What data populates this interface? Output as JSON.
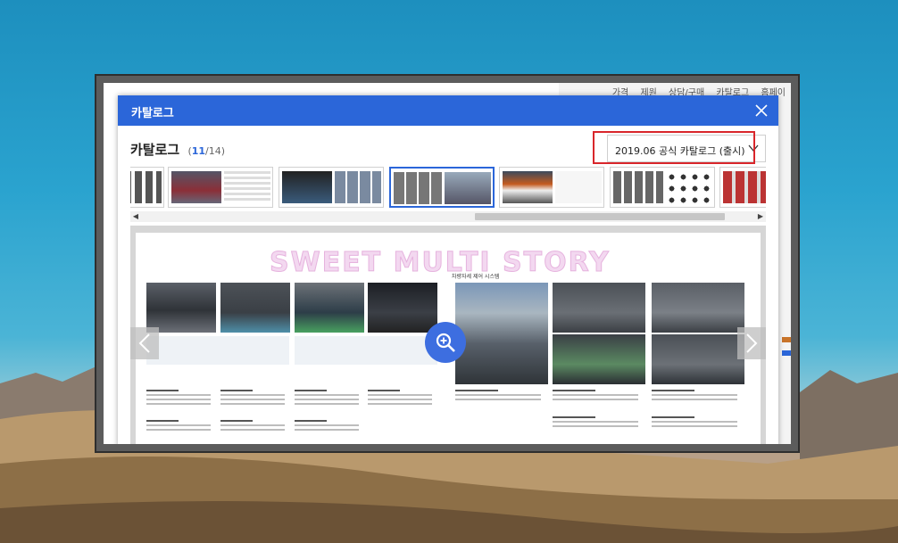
{
  "modal": {
    "header_title": "카탈로그",
    "catalog_title": "카탈로그",
    "count_current": "11",
    "count_total": "/14",
    "count_open": "(",
    "count_close": ")",
    "selected_catalog": "2019.06 공식 카탈로그 (출시)"
  },
  "background_nav": [
    "가격",
    "제원",
    "상담/구매",
    "카탈로그",
    "홈페이"
  ],
  "watermark": "SWEET MULTI STORY",
  "section_title": "차량자세 제어 시스템",
  "thumbnails": [
    {
      "label": "page-9"
    },
    {
      "label": "page-10"
    },
    {
      "label": "page-11"
    },
    {
      "label": "page-12",
      "active": true
    },
    {
      "label": "page-13"
    },
    {
      "label": "page-14"
    },
    {
      "label": "page-15"
    }
  ],
  "icons": {
    "close": "close-icon",
    "chevron": "chevron-down-icon",
    "prev": "chevron-left-icon",
    "next": "chevron-right-icon",
    "zoom": "zoom-in-icon"
  },
  "colors": {
    "header": "#2b66d9",
    "highlight": "#d9262b",
    "zoom": "#3d6ee0"
  }
}
